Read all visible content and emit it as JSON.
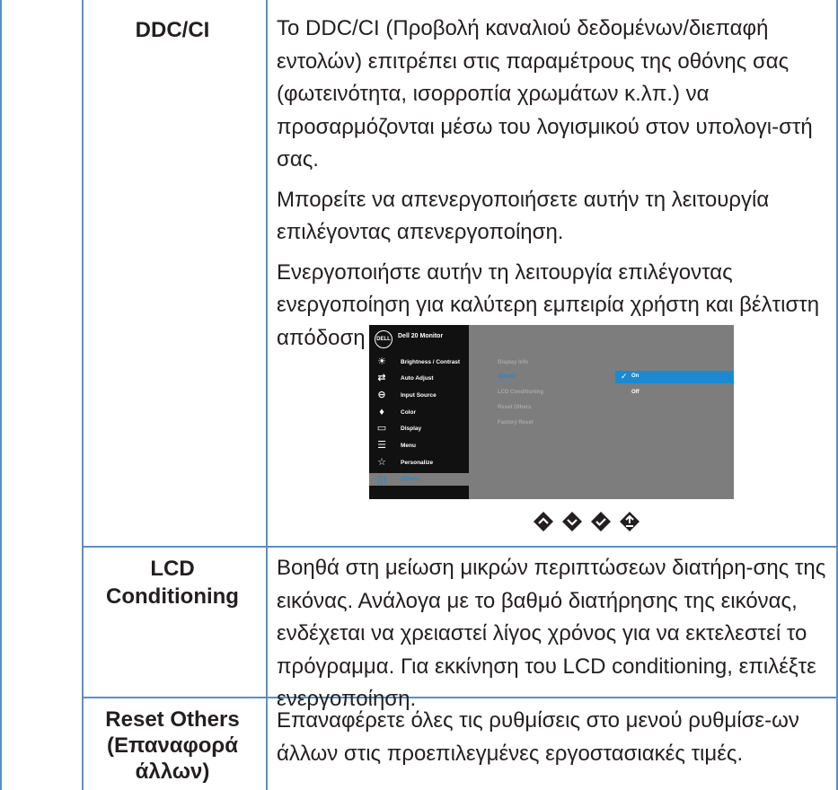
{
  "rows": [
    {
      "label": "DDC/CI",
      "paragraphs": [
        "Το DDC/CI (Προβολή καναλιού δεδομένων/διεπαφή εντολών) επιτρέπει στις παραμέτρους της οθόνης σας (φωτεινότητα, ισορροπία χρωμάτων κ.λπ.) να προσαρμόζονται μέσω του λογισμικού στον υπολογι-στή σας.",
        "Μπορείτε να απενεργοποιήσετε αυτήν τη λειτουργία επιλέγοντας απενεργοποίηση.",
        "Ενεργοποιήστε αυτήν τη λειτουργία επιλέγοντας ενεργοποίηση για καλύτερη εμπειρία χρήστη και βέλτιστη απόδοση της οθόνης σας."
      ]
    },
    {
      "label_line1": "LCD",
      "label_line2": "Conditioning",
      "paragraphs": [
        "Βοηθά στη μείωση μικρών περιπτώσεων διατήρη-σης της εικόνας. Ανάλογα με το βαθμό διατήρησης της εικόνας, ενδέχεται να χρειαστεί λίγος χρόνος για να εκτελεστεί το πρόγραμμα. Για εκκίνηση του LCD conditioning, επιλέξτε ενεργοποίηση."
      ]
    },
    {
      "label_line1": "Reset Others",
      "label_line2": "(Επαναφορά",
      "label_line3": "άλλων)",
      "paragraphs": [
        "Επαναφέρετε όλες τις ρυθμίσεις στο μενού ρυθμίσε-ων άλλων στις προεπιλεγμένες εργοστασιακές τιμές."
      ]
    }
  ],
  "osd": {
    "logo": "DELL",
    "title": "Dell 20 Monitor",
    "menu": [
      {
        "label": "Brightness / Contrast",
        "icon": "brightness-icon"
      },
      {
        "label": "Auto Adjust",
        "icon": "auto-adjust-icon"
      },
      {
        "label": "Input Source",
        "icon": "input-source-icon"
      },
      {
        "label": "Color",
        "icon": "color-icon"
      },
      {
        "label": "Display",
        "icon": "display-icon"
      },
      {
        "label": "Menu",
        "icon": "menu-icon"
      },
      {
        "label": "Personalize",
        "icon": "star-icon"
      },
      {
        "label": "Others",
        "icon": "others-icon"
      }
    ],
    "submenu": [
      "Display Info",
      "DDC/CI",
      "LCD Conditioning",
      "Reset Others",
      "Factory Reset"
    ],
    "options": [
      "On",
      "Off"
    ],
    "selected_option": "On",
    "colors": {
      "accent": "#1a8ad4",
      "panel": "#7d7d7d",
      "sidebar": "#111111"
    }
  },
  "nav_buttons": [
    "up-arrow-icon",
    "down-arrow-icon",
    "check-icon",
    "back-icon"
  ],
  "colors": {
    "rule": "#5b8fc7",
    "text": "#231f20"
  }
}
